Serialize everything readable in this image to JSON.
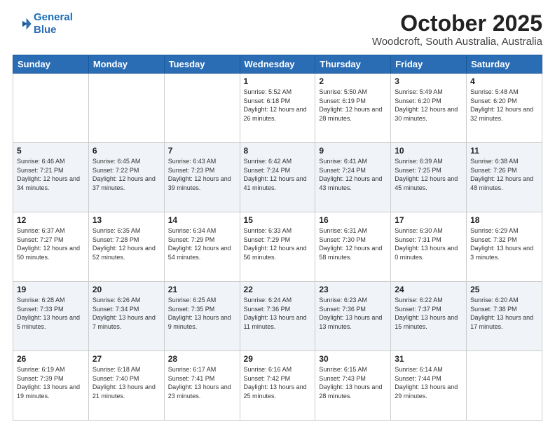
{
  "header": {
    "logo_line1": "General",
    "logo_line2": "Blue",
    "title": "October 2025",
    "subtitle": "Woodcroft, South Australia, Australia"
  },
  "days_of_week": [
    "Sunday",
    "Monday",
    "Tuesday",
    "Wednesday",
    "Thursday",
    "Friday",
    "Saturday"
  ],
  "weeks": [
    [
      {
        "day": "",
        "info": ""
      },
      {
        "day": "",
        "info": ""
      },
      {
        "day": "",
        "info": ""
      },
      {
        "day": "1",
        "info": "Sunrise: 5:52 AM\nSunset: 6:18 PM\nDaylight: 12 hours\nand 26 minutes."
      },
      {
        "day": "2",
        "info": "Sunrise: 5:50 AM\nSunset: 6:19 PM\nDaylight: 12 hours\nand 28 minutes."
      },
      {
        "day": "3",
        "info": "Sunrise: 5:49 AM\nSunset: 6:20 PM\nDaylight: 12 hours\nand 30 minutes."
      },
      {
        "day": "4",
        "info": "Sunrise: 5:48 AM\nSunset: 6:20 PM\nDaylight: 12 hours\nand 32 minutes."
      }
    ],
    [
      {
        "day": "5",
        "info": "Sunrise: 6:46 AM\nSunset: 7:21 PM\nDaylight: 12 hours\nand 34 minutes."
      },
      {
        "day": "6",
        "info": "Sunrise: 6:45 AM\nSunset: 7:22 PM\nDaylight: 12 hours\nand 37 minutes."
      },
      {
        "day": "7",
        "info": "Sunrise: 6:43 AM\nSunset: 7:23 PM\nDaylight: 12 hours\nand 39 minutes."
      },
      {
        "day": "8",
        "info": "Sunrise: 6:42 AM\nSunset: 7:24 PM\nDaylight: 12 hours\nand 41 minutes."
      },
      {
        "day": "9",
        "info": "Sunrise: 6:41 AM\nSunset: 7:24 PM\nDaylight: 12 hours\nand 43 minutes."
      },
      {
        "day": "10",
        "info": "Sunrise: 6:39 AM\nSunset: 7:25 PM\nDaylight: 12 hours\nand 45 minutes."
      },
      {
        "day": "11",
        "info": "Sunrise: 6:38 AM\nSunset: 7:26 PM\nDaylight: 12 hours\nand 48 minutes."
      }
    ],
    [
      {
        "day": "12",
        "info": "Sunrise: 6:37 AM\nSunset: 7:27 PM\nDaylight: 12 hours\nand 50 minutes."
      },
      {
        "day": "13",
        "info": "Sunrise: 6:35 AM\nSunset: 7:28 PM\nDaylight: 12 hours\nand 52 minutes."
      },
      {
        "day": "14",
        "info": "Sunrise: 6:34 AM\nSunset: 7:29 PM\nDaylight: 12 hours\nand 54 minutes."
      },
      {
        "day": "15",
        "info": "Sunrise: 6:33 AM\nSunset: 7:29 PM\nDaylight: 12 hours\nand 56 minutes."
      },
      {
        "day": "16",
        "info": "Sunrise: 6:31 AM\nSunset: 7:30 PM\nDaylight: 12 hours\nand 58 minutes."
      },
      {
        "day": "17",
        "info": "Sunrise: 6:30 AM\nSunset: 7:31 PM\nDaylight: 13 hours\nand 0 minutes."
      },
      {
        "day": "18",
        "info": "Sunrise: 6:29 AM\nSunset: 7:32 PM\nDaylight: 13 hours\nand 3 minutes."
      }
    ],
    [
      {
        "day": "19",
        "info": "Sunrise: 6:28 AM\nSunset: 7:33 PM\nDaylight: 13 hours\nand 5 minutes."
      },
      {
        "day": "20",
        "info": "Sunrise: 6:26 AM\nSunset: 7:34 PM\nDaylight: 13 hours\nand 7 minutes."
      },
      {
        "day": "21",
        "info": "Sunrise: 6:25 AM\nSunset: 7:35 PM\nDaylight: 13 hours\nand 9 minutes."
      },
      {
        "day": "22",
        "info": "Sunrise: 6:24 AM\nSunset: 7:36 PM\nDaylight: 13 hours\nand 11 minutes."
      },
      {
        "day": "23",
        "info": "Sunrise: 6:23 AM\nSunset: 7:36 PM\nDaylight: 13 hours\nand 13 minutes."
      },
      {
        "day": "24",
        "info": "Sunrise: 6:22 AM\nSunset: 7:37 PM\nDaylight: 13 hours\nand 15 minutes."
      },
      {
        "day": "25",
        "info": "Sunrise: 6:20 AM\nSunset: 7:38 PM\nDaylight: 13 hours\nand 17 minutes."
      }
    ],
    [
      {
        "day": "26",
        "info": "Sunrise: 6:19 AM\nSunset: 7:39 PM\nDaylight: 13 hours\nand 19 minutes."
      },
      {
        "day": "27",
        "info": "Sunrise: 6:18 AM\nSunset: 7:40 PM\nDaylight: 13 hours\nand 21 minutes."
      },
      {
        "day": "28",
        "info": "Sunrise: 6:17 AM\nSunset: 7:41 PM\nDaylight: 13 hours\nand 23 minutes."
      },
      {
        "day": "29",
        "info": "Sunrise: 6:16 AM\nSunset: 7:42 PM\nDaylight: 13 hours\nand 25 minutes."
      },
      {
        "day": "30",
        "info": "Sunrise: 6:15 AM\nSunset: 7:43 PM\nDaylight: 13 hours\nand 28 minutes."
      },
      {
        "day": "31",
        "info": "Sunrise: 6:14 AM\nSunset: 7:44 PM\nDaylight: 13 hours\nand 29 minutes."
      },
      {
        "day": "",
        "info": ""
      }
    ]
  ]
}
